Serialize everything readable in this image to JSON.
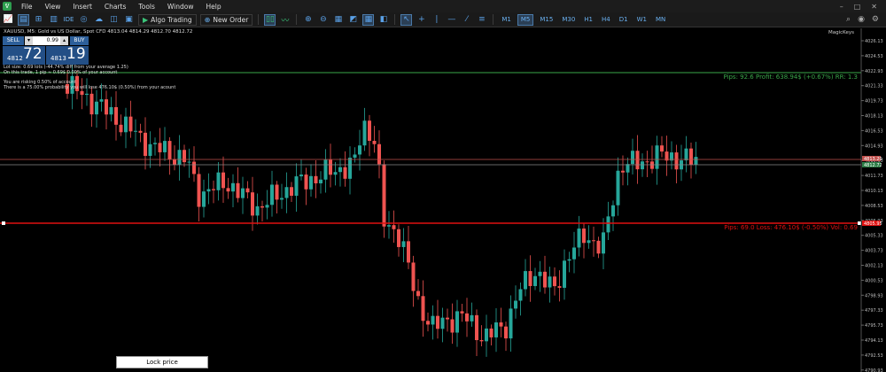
{
  "menu": {
    "items": [
      "File",
      "View",
      "Insert",
      "Charts",
      "Tools",
      "Window",
      "Help"
    ],
    "controls": [
      "–",
      "□",
      "✕"
    ]
  },
  "toolbar": {
    "ide_label": "IDE",
    "algo_trading_label": "Algo Trading",
    "new_order_label": "New Order",
    "timeframes": [
      "M1",
      "M5",
      "M15",
      "M30",
      "H1",
      "H4",
      "D1",
      "W1",
      "MN"
    ],
    "active_timeframe": "M5"
  },
  "chart": {
    "symbol_line": "XAUUSD, M5: Gold vs US Dollar, Spot CFD  4813.04 4814.29 4812.70 4812.72",
    "magickeys_label": "MagicKeys",
    "price_labels": [
      "4026.13",
      "4024.53",
      "4022.93",
      "4021.33",
      "4019.73",
      "4018.13",
      "4016.53",
      "4014.93",
      "4013.33",
      "4011.73",
      "4010.13",
      "4008.53",
      "4006.93",
      "4005.33",
      "4003.73",
      "4002.13",
      "4000.53",
      "4798.93",
      "4797.33",
      "4795.73",
      "4794.13",
      "4792.53",
      "4790.93"
    ],
    "marker_prices": {
      "current_top": "4813.20",
      "current_bottom": "4812.72",
      "stop": "4805.95"
    },
    "tp_text": "Pips: 92.6 Profit: 638.94$ (+0.67%) RR: 1.3",
    "sl_text": "Pips: 69.0 Loss: 476.10$ (-0.50%) Vol: 0.69",
    "colors": {
      "bull": "#26a69a",
      "bear": "#ef5350",
      "tp_line": "#3aa64a",
      "sl_line": "#e01010"
    }
  },
  "trade_panel": {
    "sell_label": "SELL",
    "buy_label": "BUY",
    "lot_value": "0.99",
    "dropdown_glyph": "▾",
    "up_glyph": "▴",
    "sell_price_small": "4812",
    "sell_price_big": "72",
    "buy_price_small": "4813",
    "buy_price_big": "19"
  },
  "info_lines": [
    "Lot size: 0.69 lots (-44.74% diff from your average 1.25)",
    "On this trade, 1 pip ≈ 0.69$ 0.00% of your account",
    "You are risking 0.50% of account",
    "There is a 75.00% probability you will lose 476.10$ (0.50%) from your acount"
  ],
  "lock_price_label": "Lock price"
}
